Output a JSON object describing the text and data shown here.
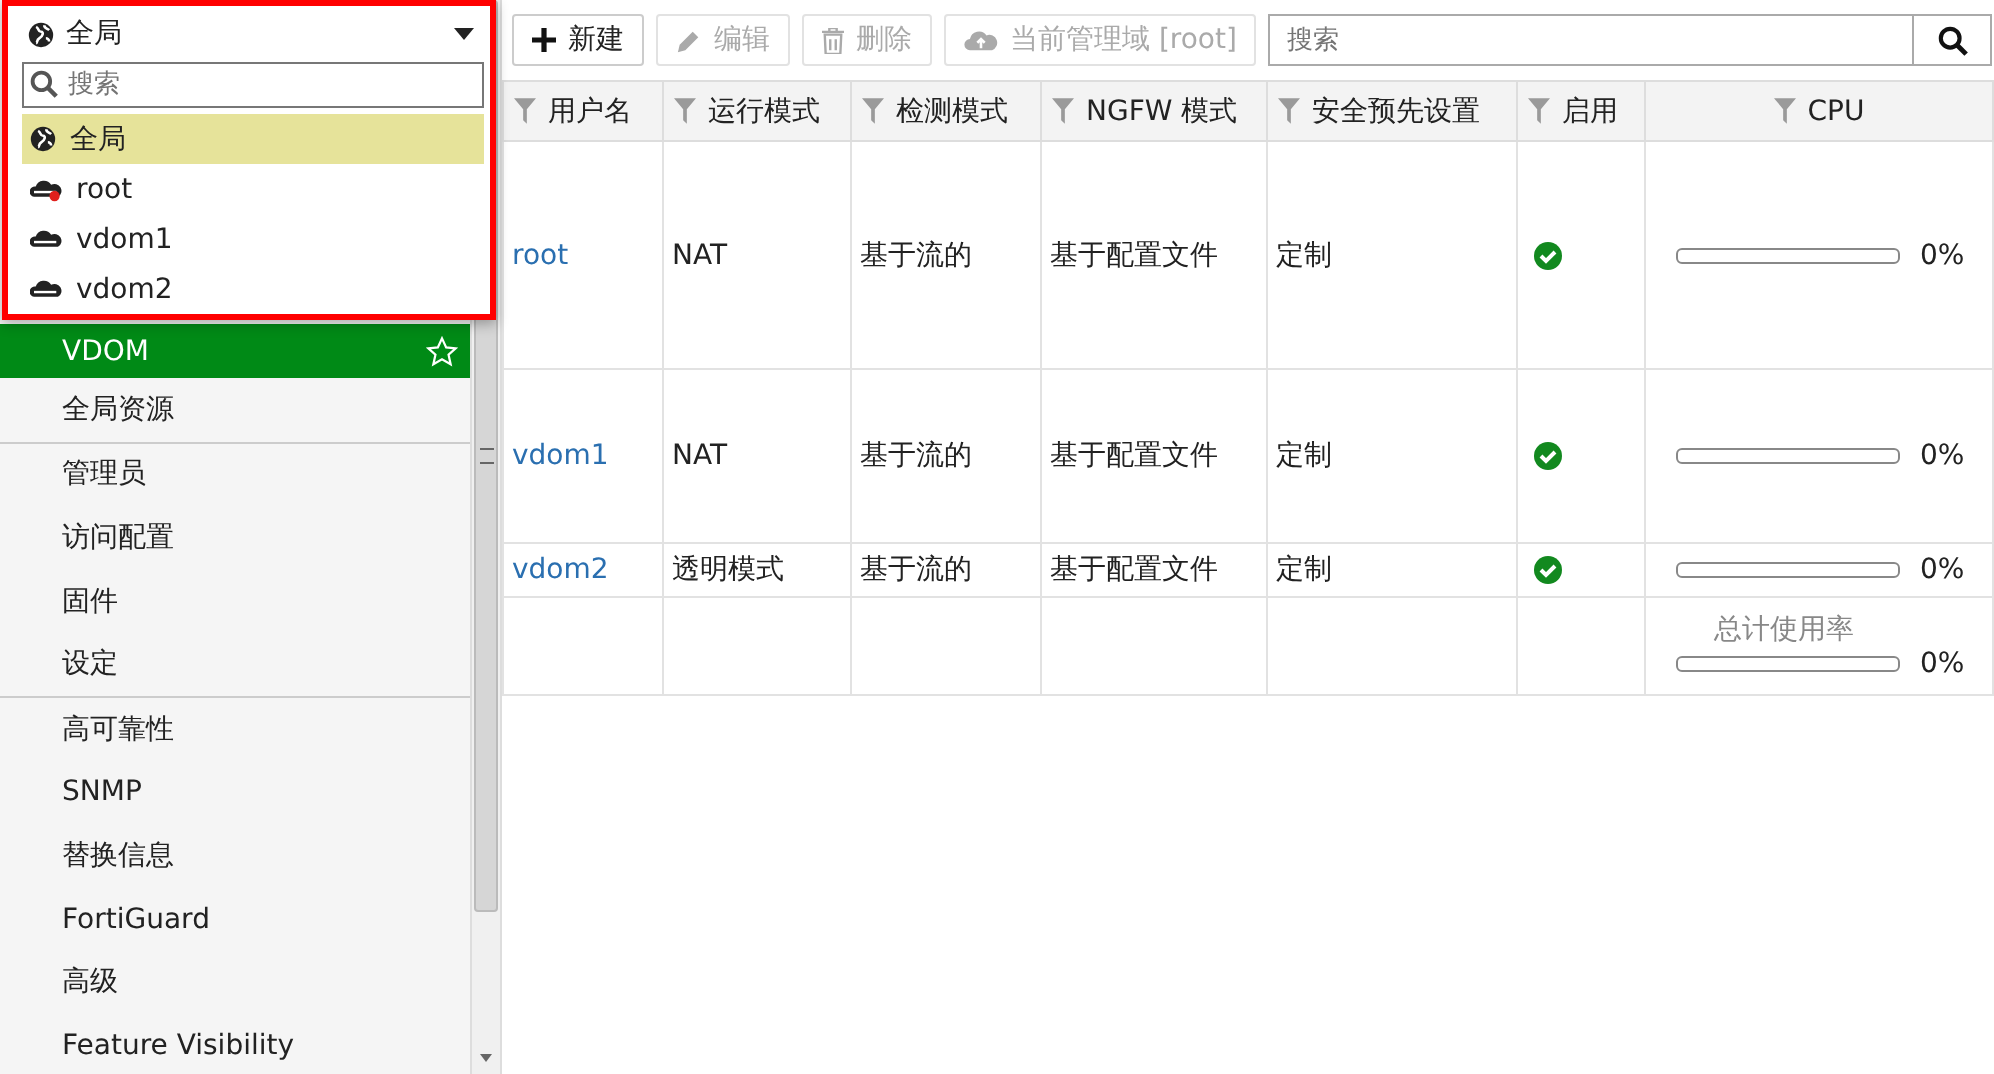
{
  "scope_dropdown": {
    "value": "全局",
    "search": {
      "placeholder": "搜索"
    },
    "options": [
      {
        "label": "全局",
        "kind": "globe",
        "selected": true
      },
      {
        "label": "root",
        "kind": "cloud-flag",
        "selected": false
      },
      {
        "label": "vdom1",
        "kind": "cloud",
        "selected": false
      },
      {
        "label": "vdom2",
        "kind": "cloud",
        "selected": false
      }
    ]
  },
  "sidebar": {
    "groups": [
      {
        "items": [
          {
            "label": "VDOM",
            "selected": true,
            "favorite": true
          },
          {
            "label": "全局资源",
            "selected": false
          }
        ]
      },
      {
        "items": [
          {
            "label": "管理员",
            "selected": false
          },
          {
            "label": "访问配置",
            "selected": false
          },
          {
            "label": "固件",
            "selected": false
          },
          {
            "label": "设定",
            "selected": false
          }
        ]
      },
      {
        "items": [
          {
            "label": "高可靠性",
            "selected": false
          },
          {
            "label": "SNMP",
            "selected": false
          },
          {
            "label": "替换信息",
            "selected": false
          },
          {
            "label": "FortiGuard",
            "selected": false
          },
          {
            "label": "高级",
            "selected": false
          },
          {
            "label": "Feature Visibility",
            "selected": false
          }
        ]
      }
    ]
  },
  "toolbar": {
    "buttons": [
      {
        "label": "新建",
        "kind": "plus",
        "disabled": false
      },
      {
        "label": "编辑",
        "kind": "pencil",
        "disabled": true
      },
      {
        "label": "删除",
        "kind": "trash",
        "disabled": true
      },
      {
        "label": "当前管理域 [root]",
        "kind": "cloud",
        "disabled": true
      }
    ],
    "search": {
      "placeholder": "搜索"
    }
  },
  "table": {
    "columns": [
      "用户名",
      "运行模式",
      "检测模式",
      "NGFW 模式",
      "安全预先设置",
      "启用",
      "CPU"
    ],
    "rows": [
      {
        "name": "root",
        "operation_mode": "NAT",
        "inspection_mode": "基于流的",
        "ngfw_mode": "基于配置文件",
        "security_preset": "定制",
        "enabled": true,
        "cpu": {
          "level": 0,
          "reading": "0%"
        }
      },
      {
        "name": "vdom1",
        "operation_mode": "NAT",
        "inspection_mode": "基于流的",
        "ngfw_mode": "基于配置文件",
        "security_preset": "定制",
        "enabled": true,
        "cpu": {
          "level": 0,
          "reading": "0%"
        }
      },
      {
        "name": "vdom2",
        "operation_mode": "透明模式",
        "inspection_mode": "基于流的",
        "ngfw_mode": "基于配置文件",
        "security_preset": "定制",
        "enabled": true,
        "cpu": {
          "level": 0,
          "reading": "0%"
        }
      }
    ],
    "total": {
      "label": "总计使用率",
      "level": 0,
      "reading": "0%"
    }
  }
}
